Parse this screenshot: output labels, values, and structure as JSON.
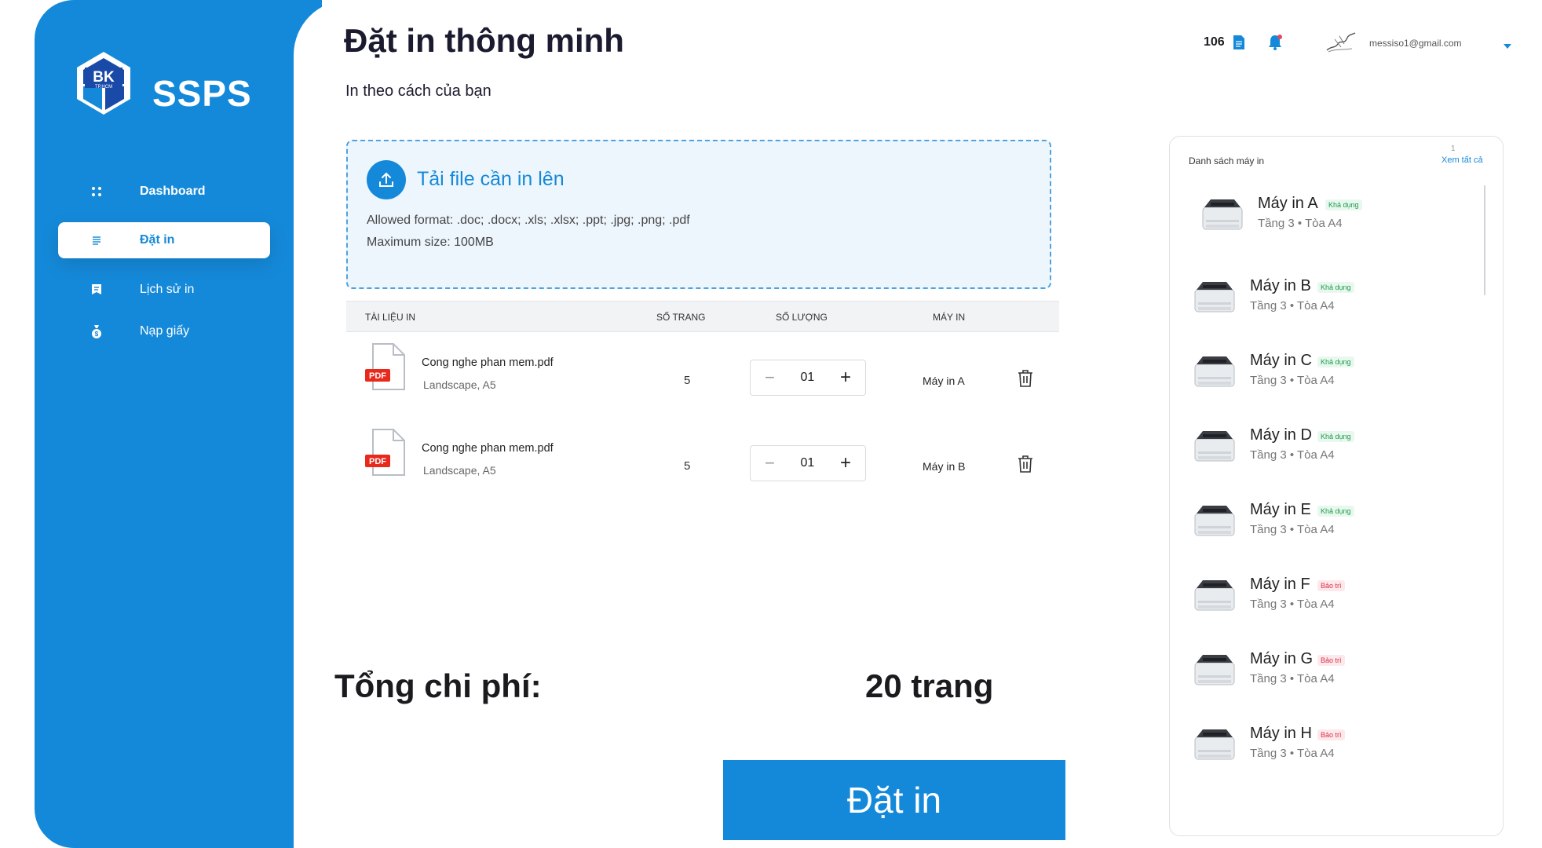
{
  "brand": {
    "name": "SSPS",
    "logo_text": "BK",
    "logo_sub": "TP.HCM"
  },
  "nav": [
    {
      "label": "Dashboard",
      "icon": "grid-icon"
    },
    {
      "label": "Đặt in",
      "icon": "document-icon"
    },
    {
      "label": "Lịch sử in",
      "icon": "history-icon"
    },
    {
      "label": "Nạp giấy",
      "icon": "money-bag-icon"
    }
  ],
  "header": {
    "title": "Đặt in thông minh",
    "subtitle": "In theo cách của bạn",
    "balance": "106",
    "email": "messiso1@gmail.com"
  },
  "upload": {
    "title": "Tải file cần in lên",
    "formats": "Allowed format: .doc; .docx; .xls; .xlsx; .ppt; .jpg; .png; .pdf",
    "max_size": "Maximum size: 100MB"
  },
  "table": {
    "columns": [
      "TÀI LIỆU IN",
      "SỐ TRANG",
      "SỐ LƯỢNG",
      "MÁY IN"
    ],
    "rows": [
      {
        "file": "Cong nghe phan mem.pdf",
        "meta": "Landscape, A5",
        "badge": "PDF",
        "pages": "5",
        "quantity": "01",
        "printer": "Máy in A"
      },
      {
        "file": "Cong nghe phan mem.pdf",
        "meta": "Landscape, A5",
        "badge": "PDF",
        "pages": "5",
        "quantity": "01",
        "printer": "Máy in B"
      }
    ]
  },
  "summary": {
    "label": "Tổng chi phí:",
    "value": "20 trang"
  },
  "submit_label": "Đặt in",
  "printer_panel": {
    "title": "Danh sách máy in",
    "count": "1",
    "view_all": "Xem tất cả",
    "printers": [
      {
        "name": "Máy in A",
        "status": "Khả dụng",
        "status_type": "available",
        "location": "Tầng 3 • Tòa A4"
      },
      {
        "name": "Máy in B",
        "status": "Khả dụng",
        "status_type": "available",
        "location": "Tầng 3 • Tòa A4"
      },
      {
        "name": "Máy in C",
        "status": "Khả dụng",
        "status_type": "available",
        "location": "Tầng 3 • Tòa A4"
      },
      {
        "name": "Máy in D",
        "status": "Khả dụng",
        "status_type": "available",
        "location": "Tầng 3 • Tòa A4"
      },
      {
        "name": "Máy in E",
        "status": "Khả dụng",
        "status_type": "available",
        "location": "Tầng 3 • Tòa A4"
      },
      {
        "name": "Máy in F",
        "status": "Bảo trì",
        "status_type": "maintenance",
        "location": "Tầng 3 • Tòa A4"
      },
      {
        "name": "Máy in G",
        "status": "Bảo trì",
        "status_type": "maintenance",
        "location": "Tầng 3 • Tòa A4"
      },
      {
        "name": "Máy in H",
        "status": "Bảo trì",
        "status_type": "maintenance",
        "location": "Tầng 3 • Tòa A4"
      }
    ]
  },
  "colors": {
    "primary": "#1589d9",
    "available": "#1a9a4a",
    "maintenance": "#d9304a"
  }
}
